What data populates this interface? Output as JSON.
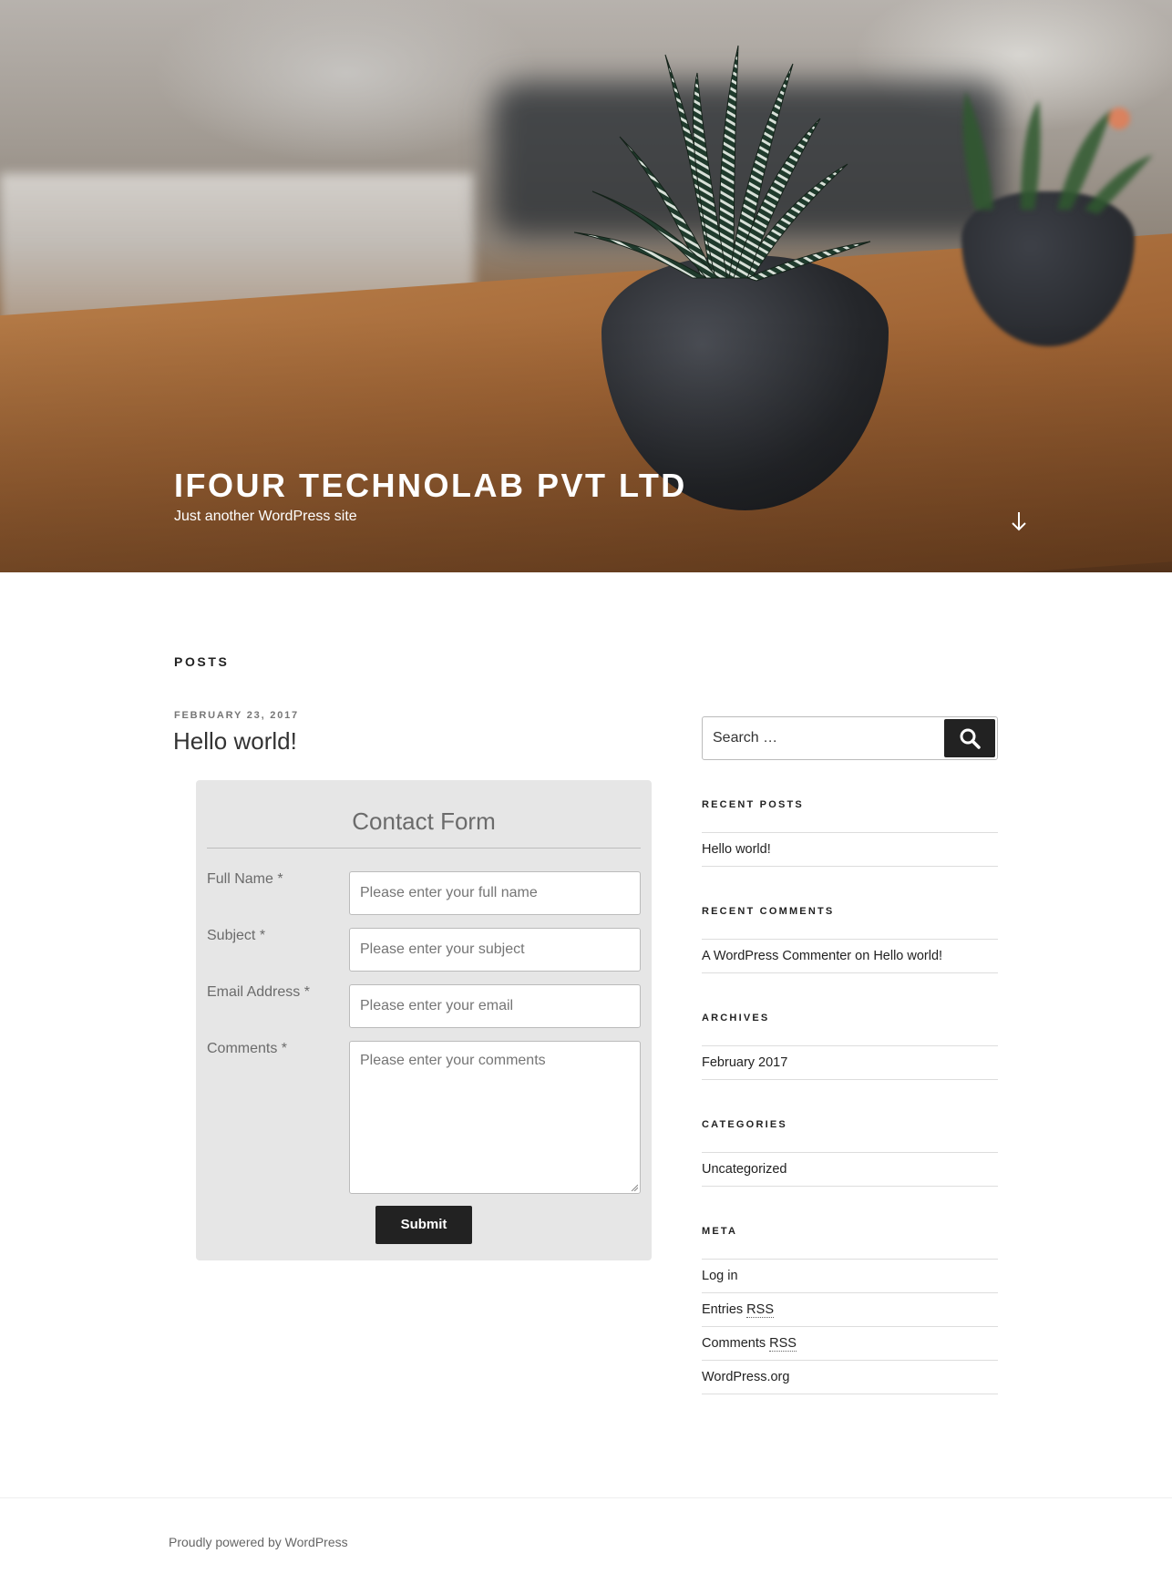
{
  "header": {
    "site_title": "IFOUR TECHNOLAB PVT LTD",
    "tagline": "Just another WordPress site",
    "scroll_icon": "arrow-down-icon"
  },
  "main": {
    "section_heading": "POSTS",
    "post": {
      "date": "FEBRUARY 23, 2017",
      "title": "Hello world!"
    },
    "contact_form": {
      "title": "Contact Form",
      "fields": [
        {
          "label": "Full Name *",
          "placeholder": "Please enter your full name"
        },
        {
          "label": "Subject *",
          "placeholder": "Please enter your subject"
        },
        {
          "label": "Email Address *",
          "placeholder": "Please enter your email"
        },
        {
          "label": "Comments *",
          "placeholder": "Please enter your comments"
        }
      ],
      "submit_label": "Submit"
    }
  },
  "sidebar": {
    "search": {
      "placeholder": "Search …",
      "icon": "search-icon"
    },
    "recent_posts": {
      "title": "RECENT POSTS",
      "items": [
        "Hello world!"
      ]
    },
    "recent_comments": {
      "title": "RECENT COMMENTS",
      "author": "A WordPress Commenter",
      "connector": "on",
      "post": "Hello world!"
    },
    "archives": {
      "title": "ARCHIVES",
      "items": [
        "February 2017"
      ]
    },
    "categories": {
      "title": "CATEGORIES",
      "items": [
        "Uncategorized"
      ]
    },
    "meta": {
      "title": "META",
      "log_in": "Log in",
      "entries_prefix": "Entries",
      "comments_prefix": "Comments",
      "rss": "RSS",
      "wordpress_org": "WordPress.org"
    }
  },
  "footer": {
    "credit": "Proudly powered by WordPress"
  },
  "colors": {
    "accent_dark": "#222222",
    "form_bg": "#e6e6e6",
    "muted_text": "#6b6b6b"
  }
}
